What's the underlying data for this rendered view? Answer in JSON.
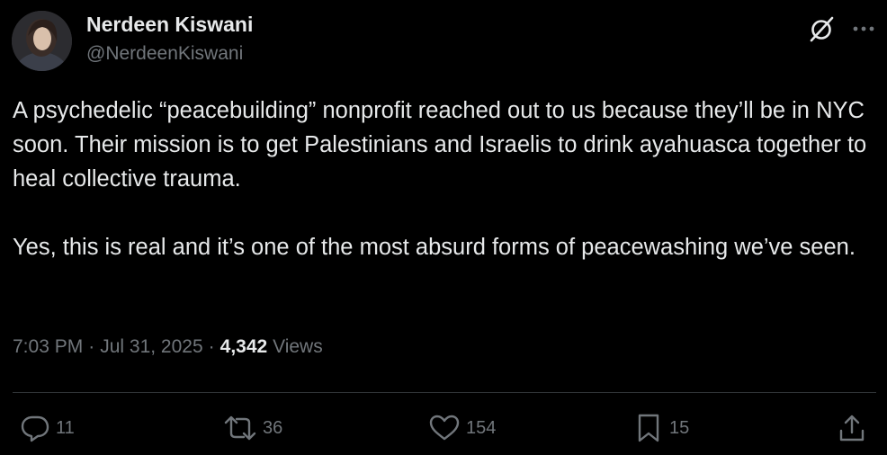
{
  "user": {
    "display_name": "Nerdeen Kiswani",
    "handle": "@NerdeenKiswani"
  },
  "icons": {
    "grok": "grok-icon",
    "more": "more-icon",
    "reply": "reply-icon",
    "repost": "repost-icon",
    "like": "like-icon",
    "bookmark": "bookmark-icon",
    "share": "share-icon"
  },
  "tweet": {
    "paragraphs": [
      "A psychedelic “peacebuilding” nonprofit reached out to us because they’ll be in NYC soon. Their mission is to get Palestinians and Israelis to drink ayahuasca together to heal collective trauma.",
      "Yes, this is real and it’s one of the most absurd forms of peacewashing we’ve seen."
    ],
    "time": "7:03 PM",
    "date": "Jul 31, 2025",
    "separator": "·",
    "views_count": "4,342",
    "views_label": "Views"
  },
  "actions": {
    "replies": "11",
    "reposts": "36",
    "likes": "154",
    "bookmarks": "15"
  },
  "colors": {
    "background": "#000000",
    "text_primary": "#e7e9ea",
    "text_secondary": "#71767b",
    "divider": "#2f3336"
  }
}
